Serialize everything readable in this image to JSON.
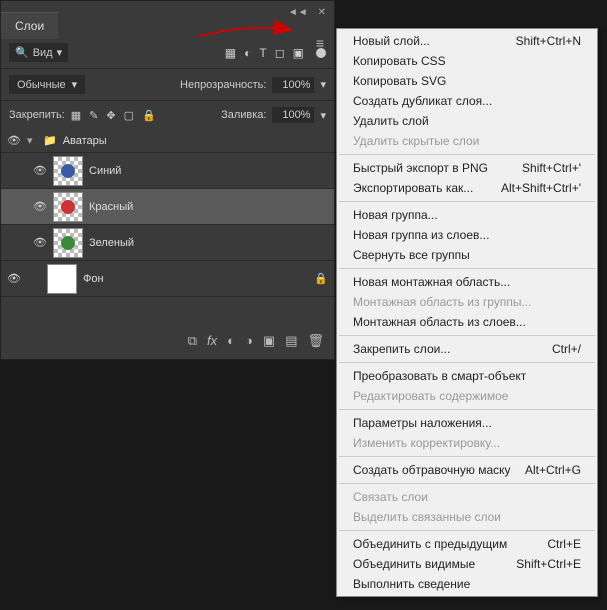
{
  "panel": {
    "tab": "Слои",
    "view_label": "Вид",
    "blend_mode": "Обычные",
    "opacity_label": "Непрозрачность:",
    "opacity_value": "100%",
    "lock_label": "Закрепить:",
    "fill_label": "Заливка:",
    "fill_value": "100%"
  },
  "layers": {
    "group": "Аватары",
    "items": [
      {
        "name": "Синий",
        "color": "#3b5aa6"
      },
      {
        "name": "Красный",
        "color": "#c33"
      },
      {
        "name": "Зеленый",
        "color": "#3a8a3a"
      }
    ],
    "bg": "Фон"
  },
  "menu": [
    {
      "label": "Новый слой...",
      "shortcut": "Shift+Ctrl+N"
    },
    {
      "label": "Копировать CSS"
    },
    {
      "label": "Копировать SVG"
    },
    {
      "label": "Создать дубликат слоя..."
    },
    {
      "label": "Удалить слой"
    },
    {
      "label": "Удалить скрытые слои",
      "disabled": true
    },
    {
      "sep": true
    },
    {
      "label": "Быстрый экспорт в PNG",
      "shortcut": "Shift+Ctrl+'"
    },
    {
      "label": "Экспортировать как...",
      "shortcut": "Alt+Shift+Ctrl+'"
    },
    {
      "sep": true
    },
    {
      "label": "Новая группа..."
    },
    {
      "label": "Новая группа из слоев..."
    },
    {
      "label": "Свернуть все группы"
    },
    {
      "sep": true
    },
    {
      "label": "Новая монтажная область..."
    },
    {
      "label": "Монтажная область из группы...",
      "disabled": true
    },
    {
      "label": "Монтажная область из слоев..."
    },
    {
      "sep": true
    },
    {
      "label": "Закрепить слои...",
      "shortcut": "Ctrl+/"
    },
    {
      "sep": true
    },
    {
      "label": "Преобразовать в смарт-объект"
    },
    {
      "label": "Редактировать содержимое",
      "disabled": true
    },
    {
      "sep": true
    },
    {
      "label": "Параметры наложения..."
    },
    {
      "label": "Изменить корректировку...",
      "disabled": true
    },
    {
      "sep": true
    },
    {
      "label": "Создать обтравочную маску",
      "shortcut": "Alt+Ctrl+G"
    },
    {
      "sep": true
    },
    {
      "label": "Связать слои",
      "disabled": true
    },
    {
      "label": "Выделить связанные слои",
      "disabled": true
    },
    {
      "sep": true
    },
    {
      "label": "Объединить с предыдущим",
      "shortcut": "Ctrl+E"
    },
    {
      "label": "Объединить видимые",
      "shortcut": "Shift+Ctrl+E"
    },
    {
      "label": "Выполнить сведение"
    }
  ]
}
